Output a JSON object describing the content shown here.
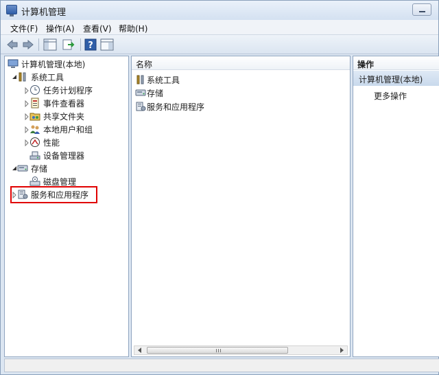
{
  "window": {
    "title": "计算机管理"
  },
  "menu": {
    "file": "文件(F)",
    "action": "操作(A)",
    "view": "查看(V)",
    "help": "帮助(H)"
  },
  "tree": {
    "root": "计算机管理(本地)",
    "system_tools": "系统工具",
    "task_scheduler": "任务计划程序",
    "event_viewer": "事件查看器",
    "shared_folders": "共享文件夹",
    "local_users": "本地用户和组",
    "performance": "性能",
    "device_manager": "设备管理器",
    "storage": "存储",
    "disk_management": "磁盘管理",
    "services_apps": "服务和应用程序"
  },
  "list": {
    "column_name": "名称",
    "items": [
      "系统工具",
      "存储",
      "服务和应用程序"
    ]
  },
  "actions": {
    "header": "操作",
    "section": "计算机管理(本地)",
    "more": "更多操作"
  },
  "colors": {
    "highlight": "#e00000",
    "accent": "#2f5ea8"
  }
}
